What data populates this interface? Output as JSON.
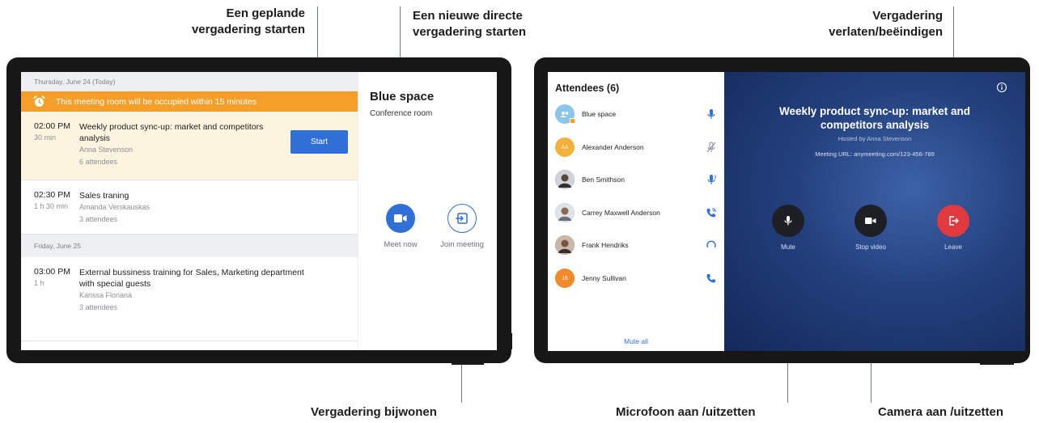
{
  "callouts": {
    "scheduled": [
      "Een geplande",
      "vergadering starten"
    ],
    "new_direct": [
      "Een nieuwe directe",
      "vergadering starten"
    ],
    "leave": [
      "Vergadering",
      "verlaten/beëindigen"
    ],
    "join": "Vergadering bijwonen",
    "mic": "Microfoon aan /uitzetten",
    "camera": "Camera aan /uitzetten"
  },
  "left_screen": {
    "date_today": "Thursday, June 24 (Today)",
    "warning": "This meeting room will be occupied within 15 minutes",
    "meetings_today": [
      {
        "time": "02:00 PM",
        "duration": "30 min",
        "title": [
          "Weekly product sync-up: market and competitors",
          "analysis"
        ],
        "host": "Anna Stevenson",
        "attendees": "6 attendees",
        "action": "Start"
      },
      {
        "time": "02:30 PM",
        "duration": "1 h 30 min",
        "title": [
          "Sales traning"
        ],
        "host": "Amanda Verskauskas",
        "attendees": "3 attendees"
      }
    ],
    "date_next": "Friday, June 25",
    "meetings_next": [
      {
        "time": "03:00 PM",
        "duration": "1 h",
        "title": [
          "External bussiness training for Sales, Marketing department",
          "with special guests"
        ],
        "host": "Karissa Floriana",
        "attendees": "3 attendees"
      }
    ],
    "room_name": "Blue space",
    "room_type": "Conference room",
    "meet_now_label": "Meet now",
    "join_meeting_label": "Join meeting",
    "colors": {
      "accent": "#2f6fd6",
      "warning": "#f59f2a",
      "active_row": "#fdf4df"
    }
  },
  "right_screen": {
    "attendees_title": "Attendees (6)",
    "attendees": [
      {
        "name": "Blue space",
        "initials": "",
        "avatar_color": "#8cc4ea",
        "status_icon": "mic-icon"
      },
      {
        "name": "Alexander Anderson",
        "initials": "AA",
        "avatar_color": "#f2b13a",
        "status_icon": "mic-off-icon"
      },
      {
        "name": "Ben Smithson",
        "initials": "",
        "avatar_color": "#5a4638",
        "status_icon": "mic-speaking-icon"
      },
      {
        "name": "Carrey Maxwell Anderson",
        "initials": "",
        "avatar_color": "#8a7a6a",
        "status_icon": "phone-ringing-icon"
      },
      {
        "name": "Frank Hendriks",
        "initials": "",
        "avatar_color": "#6b4a3c",
        "status_icon": "loading-icon"
      },
      {
        "name": "Jenny Sullivan",
        "initials": "JS",
        "avatar_color": "#f08a2c",
        "status_icon": "phone-icon"
      }
    ],
    "mute_all": "Mute all",
    "meeting_title": [
      "Weekly product sync-up: market and",
      "competitors analysis"
    ],
    "hosted_by": "Hosted by Anna Stevenson",
    "meeting_url": "Meeting URL: anymeeting.com/123-456-789",
    "buttons": {
      "mute": "Mute",
      "stop_video": "Stop video",
      "leave": "Leave"
    },
    "colors": {
      "leave": "#e0393e",
      "control": "#1d1f24"
    }
  }
}
